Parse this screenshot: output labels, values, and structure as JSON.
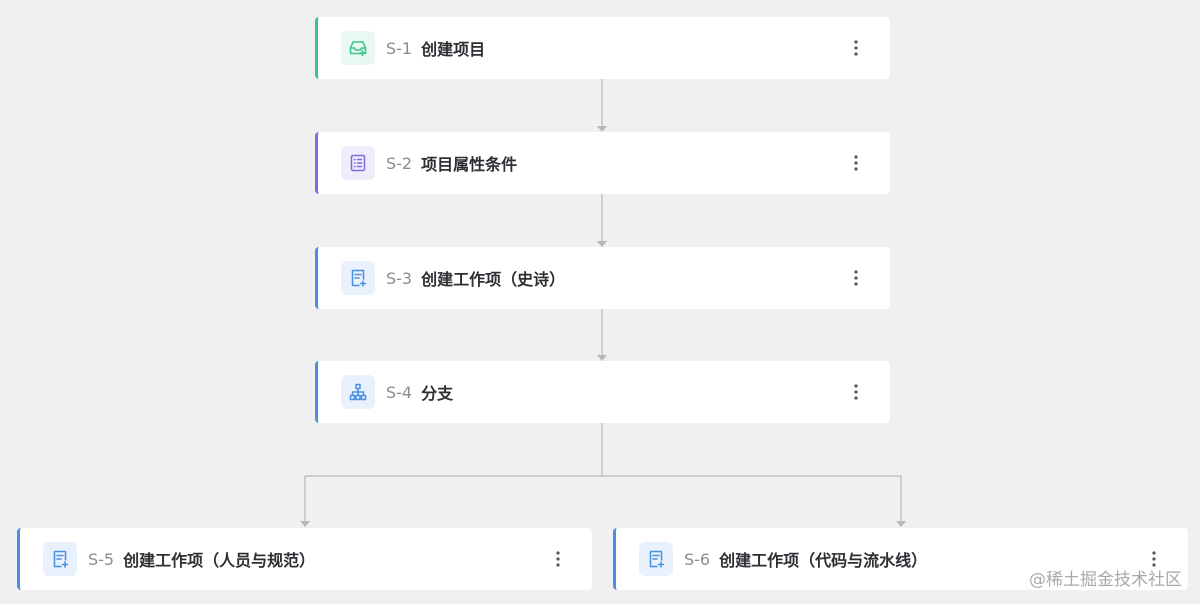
{
  "workflow": {
    "nodes": [
      {
        "id": "S-1",
        "title": "创建项目",
        "icon": "inbox-add-icon",
        "accent": "#3dc28f"
      },
      {
        "id": "S-2",
        "title": "项目属性条件",
        "icon": "list-document-icon",
        "accent": "#7b6ce3"
      },
      {
        "id": "S-3",
        "title": "创建工作项（史诗）",
        "icon": "document-add-icon",
        "accent": "#4a90e2"
      },
      {
        "id": "S-4",
        "title": "分支",
        "icon": "hierarchy-icon",
        "accent": "#4a90e2"
      },
      {
        "id": "S-5",
        "title": "创建工作项（人员与规范）",
        "icon": "document-add-icon",
        "accent": "#4a90e2"
      },
      {
        "id": "S-6",
        "title": "创建工作项（代码与流水线）",
        "icon": "document-add-icon",
        "accent": "#4a90e2"
      }
    ],
    "more_icon": "more-vertical-icon",
    "connector_color": "#b8b8b8"
  },
  "watermark": "@稀土掘金技术社区"
}
